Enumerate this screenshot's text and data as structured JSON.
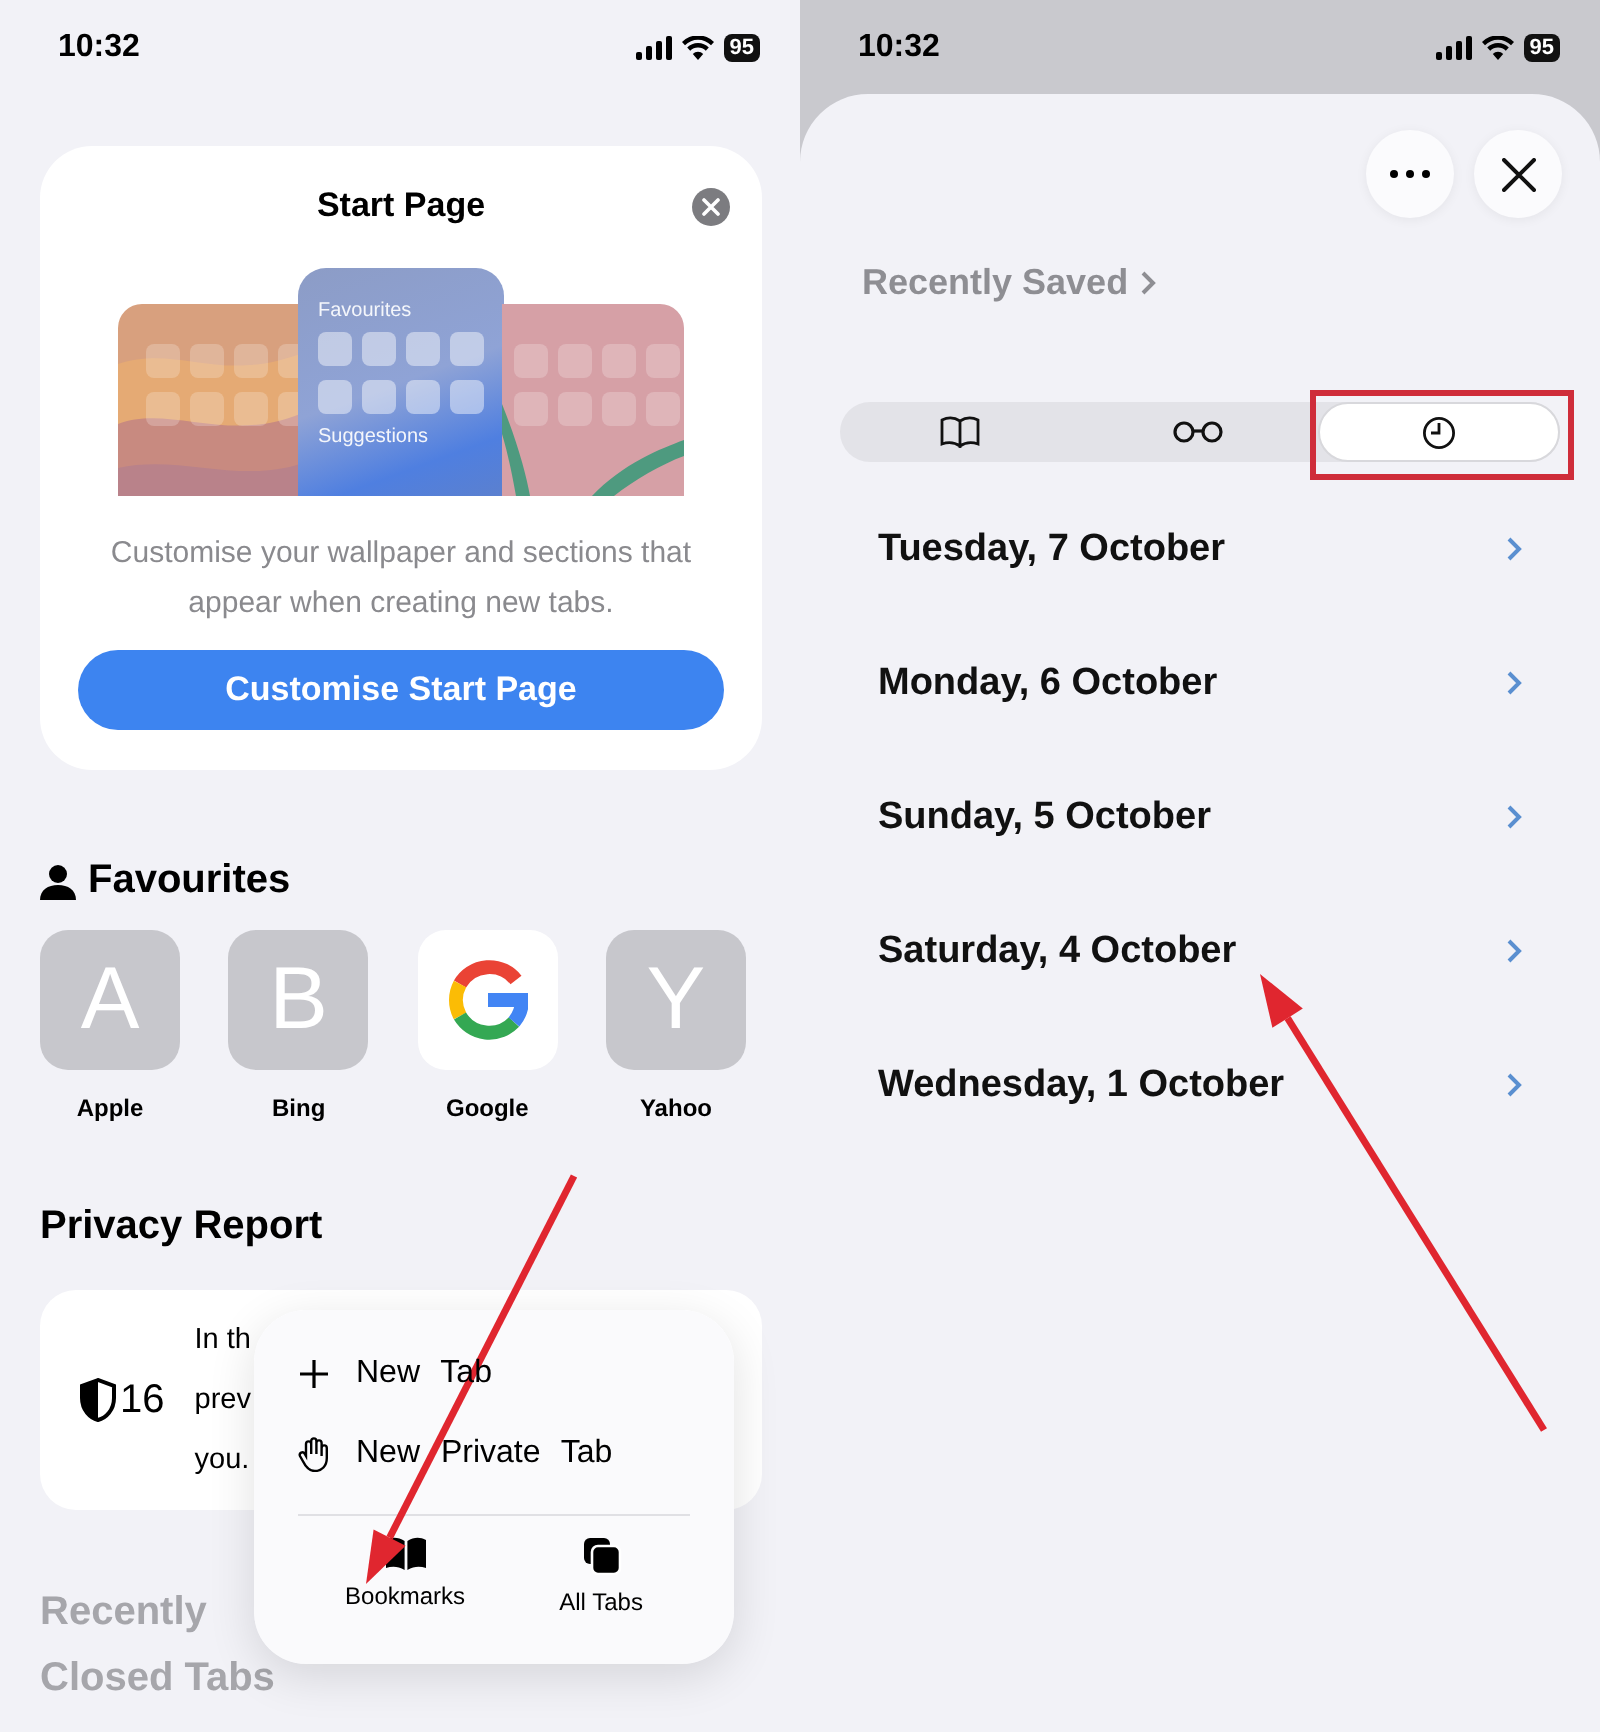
{
  "left_screen": {
    "status_bar": {
      "time": "10:32",
      "battery": "95"
    },
    "start_page_card": {
      "title": "Start Page",
      "preview_labels": [
        "Favourites",
        "Suggestions"
      ],
      "description": "Customise your wallpaper and sections that appear when creating new tabs.",
      "button": "Customise Start Page"
    },
    "favourites": {
      "title": "Favourites",
      "items": [
        {
          "kind": "letter",
          "letter": "A",
          "label": "Apple"
        },
        {
          "kind": "letter",
          "letter": "B",
          "label": "Bing"
        },
        {
          "kind": "logo",
          "label": "Google"
        },
        {
          "kind": "letter",
          "letter": "Y",
          "label": "Yahoo"
        }
      ]
    },
    "privacy_report": {
      "title": "Privacy Report",
      "count": "16",
      "text_lines": [
        "In th",
        "prev",
        "you."
      ]
    },
    "recently_closed": {
      "title_lines": [
        "Recently",
        "Closed Tabs"
      ]
    },
    "context_menu": {
      "items": [
        {
          "kind": "plus",
          "label": "New Tab"
        },
        {
          "kind": "hand",
          "label": "New Private Tab"
        }
      ],
      "actions": [
        {
          "kind": "bookmarks",
          "label": "Bookmarks"
        },
        {
          "kind": "tabs",
          "label": "All Tabs"
        }
      ]
    }
  },
  "right_screen": {
    "status_bar": {
      "time": "10:32",
      "battery": "95"
    },
    "recently_saved": "Recently Saved",
    "segments": [
      {
        "kind": "bookmarks",
        "selected": false
      },
      {
        "kind": "reading_list",
        "selected": false
      },
      {
        "kind": "history",
        "selected": true
      }
    ],
    "history_days": [
      "Tuesday, 7 October",
      "Monday, 6 October",
      "Sunday, 5 October",
      "Saturday, 4 October",
      "Wednesday, 1 October"
    ]
  }
}
